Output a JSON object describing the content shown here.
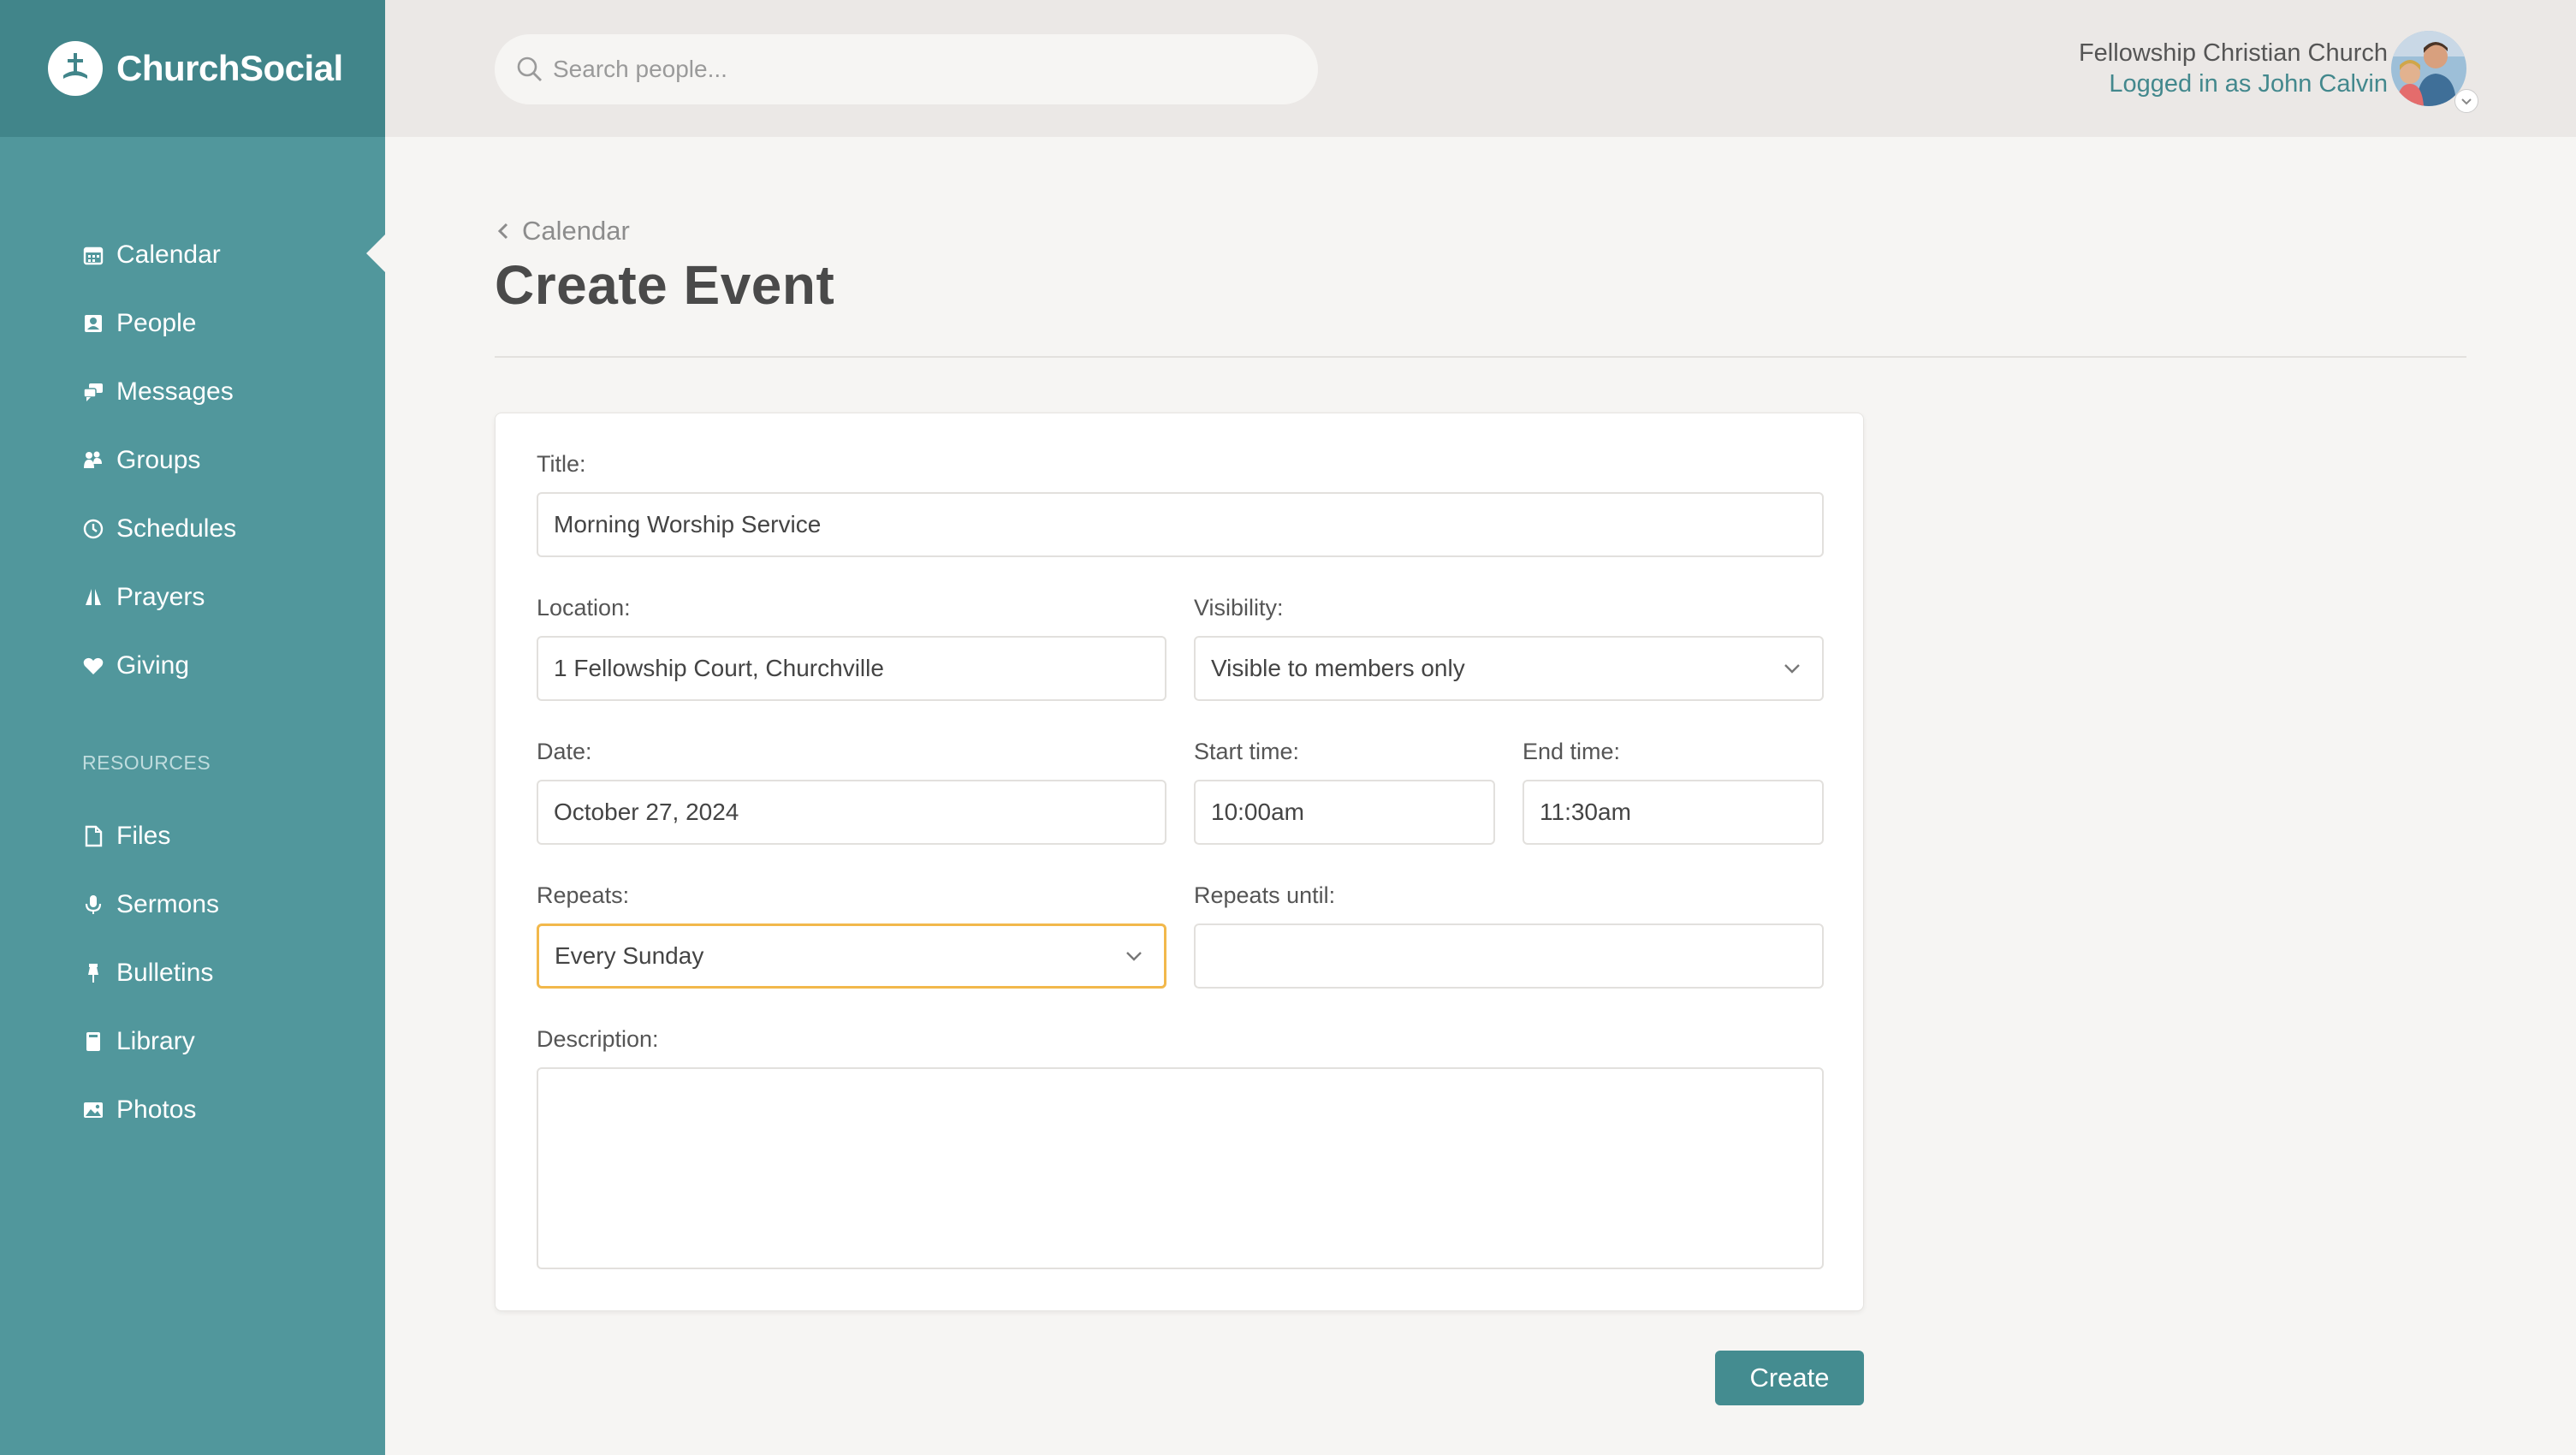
{
  "brand": {
    "name": "ChurchSocial",
    "icon": "church-cross-icon"
  },
  "sidebar": {
    "active": "Calendar",
    "items": [
      {
        "label": "Calendar",
        "icon": "calendar-icon"
      },
      {
        "label": "People",
        "icon": "contact-card-icon"
      },
      {
        "label": "Messages",
        "icon": "chat-bubbles-icon"
      },
      {
        "label": "Groups",
        "icon": "group-icon"
      },
      {
        "label": "Schedules",
        "icon": "clock-icon"
      },
      {
        "label": "Prayers",
        "icon": "praying-hands-icon"
      },
      {
        "label": "Giving",
        "icon": "heart-icon"
      }
    ],
    "resources_label": "RESOURCES",
    "resources": [
      {
        "label": "Files",
        "icon": "file-icon"
      },
      {
        "label": "Sermons",
        "icon": "microphone-icon"
      },
      {
        "label": "Bulletins",
        "icon": "pushpin-icon"
      },
      {
        "label": "Library",
        "icon": "book-icon"
      },
      {
        "label": "Photos",
        "icon": "image-icon"
      }
    ]
  },
  "header": {
    "search_placeholder": "Search people...",
    "church_name": "Fellowship Christian Church",
    "logged_in": "Logged in as John Calvin"
  },
  "breadcrumb": {
    "label": "Calendar"
  },
  "page_title": "Create Event",
  "form": {
    "title": {
      "label": "Title:",
      "value": "Morning Worship Service"
    },
    "location": {
      "label": "Location:",
      "value": "1 Fellowship Court, Churchville"
    },
    "visibility": {
      "label": "Visibility:",
      "value": "Visible to members only"
    },
    "date": {
      "label": "Date:",
      "value": "October 27, 2024"
    },
    "start_time": {
      "label": "Start time:",
      "value": "10:00am"
    },
    "end_time": {
      "label": "End time:",
      "value": "11:30am"
    },
    "repeats": {
      "label": "Repeats:",
      "value": "Every Sunday"
    },
    "repeats_until": {
      "label": "Repeats until:",
      "value": ""
    },
    "description": {
      "label": "Description:",
      "value": ""
    },
    "submit_label": "Create"
  },
  "colors": {
    "sidebar": "#51979c",
    "brand_bar": "#41858a",
    "accent": "#448c90",
    "focus": "#f2b84b"
  }
}
